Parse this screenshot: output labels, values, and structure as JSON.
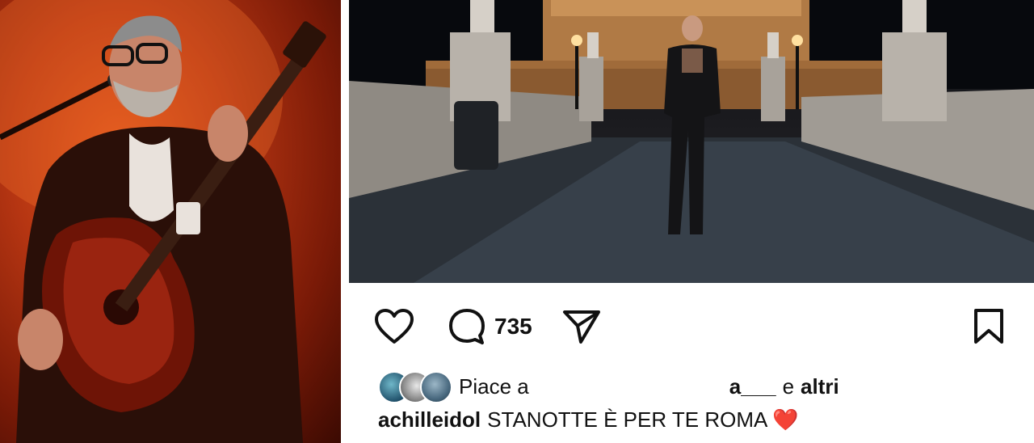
{
  "post": {
    "comment_count": "735",
    "likes": {
      "prefix": "Piace a",
      "user_partial": "a___",
      "and_text": "e",
      "others_text": "altri"
    },
    "caption": {
      "username": "achilleidol",
      "text": "STANOTTE È PER TE ROMA",
      "emoji": "❤️"
    },
    "icons": {
      "like": "heart-outline-icon",
      "comment": "comment-bubble-icon",
      "share": "paper-plane-icon",
      "save": "bookmark-icon"
    }
  }
}
